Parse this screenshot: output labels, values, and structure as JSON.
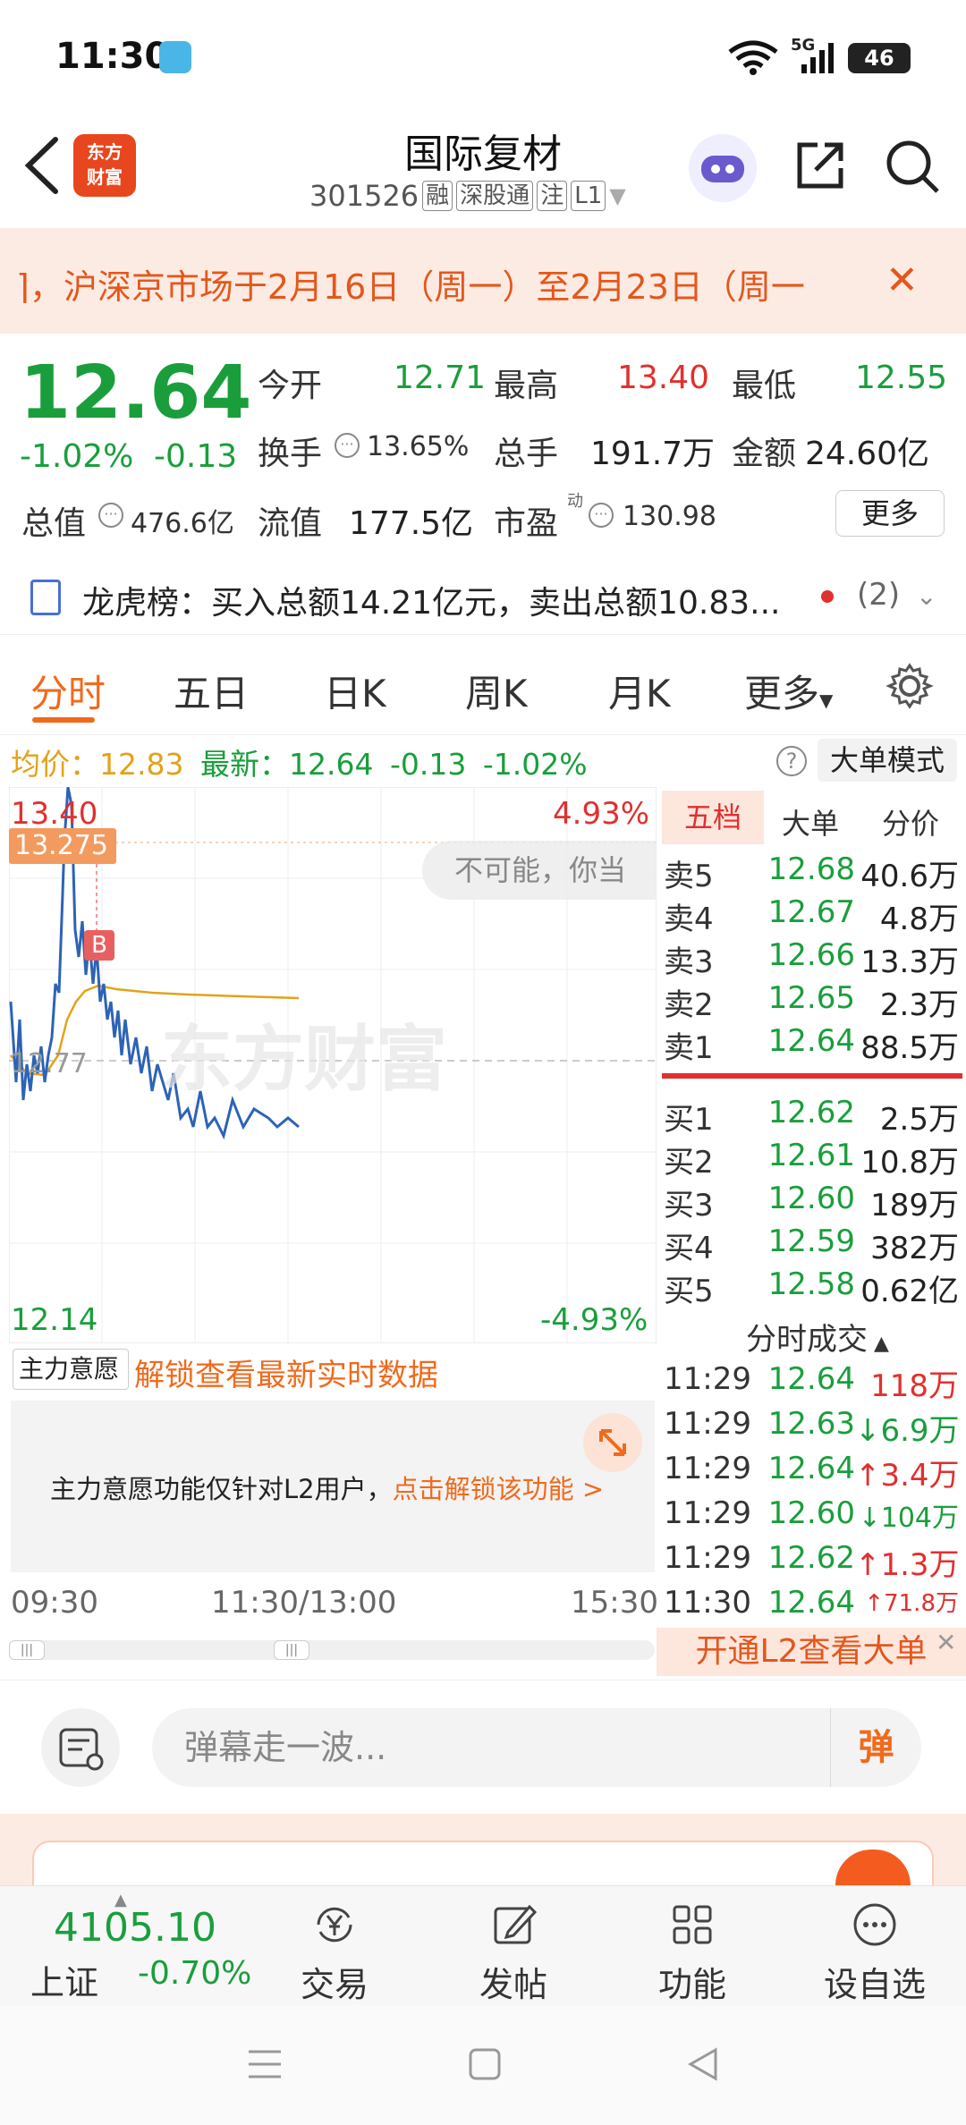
{
  "status_bar": {
    "time": "11:30",
    "network": "5G",
    "battery": "46"
  },
  "header": {
    "app_logo_line1": "东方",
    "app_logo_line2": "财富",
    "stock_name": "国际复材",
    "stock_code": "301526",
    "tags": [
      "融",
      "深股通",
      "注",
      "L1"
    ]
  },
  "notice": {
    "text": "⌉，沪深京市场于2月16日（周一）至2月23日（周一"
  },
  "quote": {
    "price": "12.64",
    "pct": "-1.02%",
    "change": "-0.13",
    "open_label": "今开",
    "open": "12.71",
    "high_label": "最高",
    "high": "13.40",
    "low_label": "最低",
    "low": "12.55",
    "turnover_label": "换手",
    "turnover": "13.65%",
    "volume_label": "总手",
    "volume": "191.7万",
    "amount_label": "金额",
    "amount": "24.60亿",
    "mktcap_label": "总值",
    "mktcap": "476.6亿",
    "float_label": "流值",
    "float": "177.5亿",
    "pe_label": "市盈",
    "pe_sup": "动",
    "pe": "130.98",
    "more": "更多"
  },
  "dragon_tiger": {
    "text": "龙虎榜：买入总额14.21亿元，卖出总额10.83...",
    "count": "(2)"
  },
  "tabs": [
    "分时",
    "五日",
    "日K",
    "周K",
    "月K",
    "更多"
  ],
  "info_row": {
    "avg_label": "均价：",
    "avg": "12.83",
    "latest_label": "最新：",
    "latest": "12.64",
    "change": "-0.13",
    "pct": "-1.02%",
    "big_order_mode": "大单模式"
  },
  "chart": {
    "high": "13.40",
    "high_pct": "4.93%",
    "low": "12.14",
    "low_pct": "-4.93%",
    "cursor_price": "13.275",
    "mid_label": "12.77",
    "buy_marker": "B",
    "danmu": "不可能，你当",
    "watermark": "东方财富",
    "time_start": "09:30",
    "time_mid": "11:30/13:00",
    "time_end": "15:30"
  },
  "l2": {
    "select": "主力意愿",
    "unlock": "解锁查看最新实时数据",
    "text": "主力意愿功能仅针对L2用户，",
    "link": "点击解锁该功能 >"
  },
  "order_book": {
    "tabs": [
      "五档",
      "大单",
      "分价"
    ],
    "sell": [
      {
        "label": "卖5",
        "price": "12.68",
        "vol": "40.6万"
      },
      {
        "label": "卖4",
        "price": "12.67",
        "vol": "4.8万"
      },
      {
        "label": "卖3",
        "price": "12.66",
        "vol": "13.3万"
      },
      {
        "label": "卖2",
        "price": "12.65",
        "vol": "2.3万"
      },
      {
        "label": "卖1",
        "price": "12.64",
        "vol": "88.5万"
      }
    ],
    "buy": [
      {
        "label": "买1",
        "price": "12.62",
        "vol": "2.5万"
      },
      {
        "label": "买2",
        "price": "12.61",
        "vol": "10.8万"
      },
      {
        "label": "买3",
        "price": "12.60",
        "vol": "189万"
      },
      {
        "label": "买4",
        "price": "12.59",
        "vol": "382万"
      },
      {
        "label": "买5",
        "price": "12.58",
        "vol": "0.62亿"
      }
    ],
    "ticks_title": "分时成交",
    "ticks": [
      {
        "time": "11:29",
        "price": "12.64",
        "vol": "118万"
      },
      {
        "time": "11:29",
        "price": "12.63",
        "vol": "↓6.9万"
      },
      {
        "time": "11:29",
        "price": "12.64",
        "vol": "↑3.4万"
      },
      {
        "time": "11:29",
        "price": "12.60",
        "vol": "↓104万"
      },
      {
        "time": "11:29",
        "price": "12.62",
        "vol": "↑1.3万"
      },
      {
        "time": "11:30",
        "price": "12.64",
        "vol": "↑71.8万"
      }
    ],
    "l2_banner": "开通L2查看大单"
  },
  "comment": {
    "placeholder": "弹幕走一波...",
    "danmu_btn": "弹"
  },
  "bottom_bar": {
    "index_value": "4105.10",
    "index_name": "上证",
    "index_pct": "-0.70%",
    "items": [
      "交易",
      "发帖",
      "功能",
      "设自选"
    ]
  }
}
